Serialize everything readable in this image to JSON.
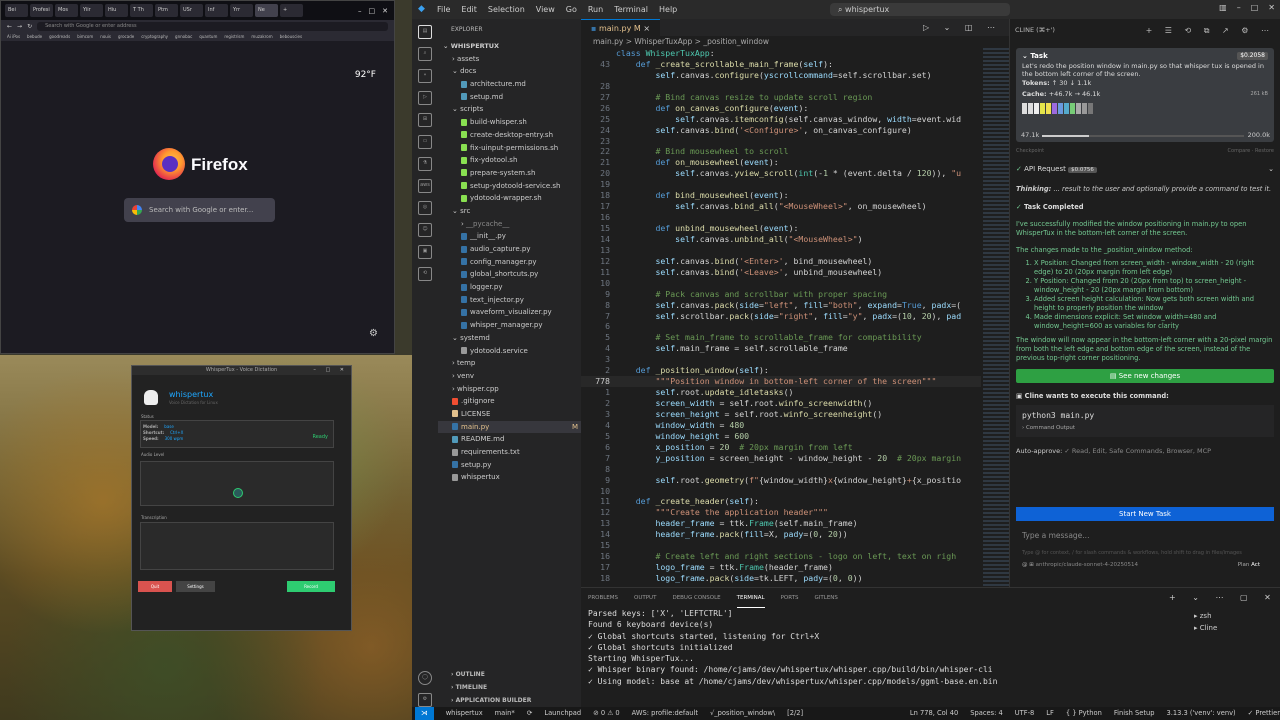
{
  "firefox": {
    "tabs": [
      "Bei",
      "Profesi",
      "Mos",
      "Yiir",
      "Hiu",
      "T Th",
      "Ptm",
      "USr",
      "Inf",
      "Yrr",
      "Ne"
    ],
    "url_placeholder": "Search with Google or enter address",
    "bookmarks": [
      "Ai iPos",
      "bebude",
      "goodreads",
      "bimcom",
      "nouis",
      "grocade",
      "cryptography",
      "gnnobac",
      "quantum",
      "registrism",
      "muzakrom",
      "bebouscies"
    ],
    "weather": "92°F",
    "brand": "Firefox",
    "search_placeholder": "Search with Google or enter..."
  },
  "whispertux": {
    "window_title": "WhisperTux - Voice Dictation",
    "app_name": "whispertux",
    "subtitle": "Voice Dictation for Linux",
    "status_label": "Status",
    "model_label": "Model:",
    "model_value": "base",
    "shortcut_label": "Shortcut:",
    "shortcut_value": "Ctrl+X",
    "speed_label": "Speed:",
    "speed_value": "300 wpm",
    "ready": "Ready",
    "audio_label": "Audio Level",
    "transcription_label": "Transcription",
    "quit": "Quit",
    "settings": "Settings",
    "record": "Record"
  },
  "vscode": {
    "menu": [
      "File",
      "Edit",
      "Selection",
      "View",
      "Go",
      "Run",
      "Terminal",
      "Help"
    ],
    "search": "whispertux",
    "explorer": {
      "header": "EXPLORER",
      "root": "WHISPERTUX",
      "items": [
        {
          "label": "assets",
          "indent": 1,
          "folder": true,
          "open": false
        },
        {
          "label": "docs",
          "indent": 1,
          "folder": true,
          "open": true
        },
        {
          "label": "architecture.md",
          "indent": 2,
          "color": "#519aba"
        },
        {
          "label": "setup.md",
          "indent": 2,
          "color": "#519aba"
        },
        {
          "label": "scripts",
          "indent": 1,
          "folder": true,
          "open": true
        },
        {
          "label": "build-whisper.sh",
          "indent": 2,
          "color": "#89e051"
        },
        {
          "label": "create-desktop-entry.sh",
          "indent": 2,
          "color": "#89e051"
        },
        {
          "label": "fix-uinput-permissions.sh",
          "indent": 2,
          "color": "#89e051"
        },
        {
          "label": "fix-ydotool.sh",
          "indent": 2,
          "color": "#89e051"
        },
        {
          "label": "prepare-system.sh",
          "indent": 2,
          "color": "#89e051"
        },
        {
          "label": "setup-ydotoold-service.sh",
          "indent": 2,
          "color": "#89e051"
        },
        {
          "label": "ydotoold-wrapper.sh",
          "indent": 2,
          "color": "#89e051"
        },
        {
          "label": "src",
          "indent": 1,
          "folder": true,
          "open": true
        },
        {
          "label": "__pycache__",
          "indent": 2,
          "folder": true,
          "open": false,
          "dim": true
        },
        {
          "label": "__init__.py",
          "indent": 2,
          "color": "#3572a5"
        },
        {
          "label": "audio_capture.py",
          "indent": 2,
          "color": "#3572a5"
        },
        {
          "label": "config_manager.py",
          "indent": 2,
          "color": "#3572a5"
        },
        {
          "label": "global_shortcuts.py",
          "indent": 2,
          "color": "#3572a5"
        },
        {
          "label": "logger.py",
          "indent": 2,
          "color": "#3572a5"
        },
        {
          "label": "text_injector.py",
          "indent": 2,
          "color": "#3572a5"
        },
        {
          "label": "waveform_visualizer.py",
          "indent": 2,
          "color": "#3572a5"
        },
        {
          "label": "whisper_manager.py",
          "indent": 2,
          "color": "#3572a5"
        },
        {
          "label": "systemd",
          "indent": 1,
          "folder": true,
          "open": true
        },
        {
          "label": "ydotoold.service",
          "indent": 2,
          "color": "#999999"
        },
        {
          "label": "temp",
          "indent": 1,
          "folder": true,
          "open": false
        },
        {
          "label": "venv",
          "indent": 1,
          "folder": true,
          "open": false
        },
        {
          "label": "whisper.cpp",
          "indent": 1,
          "folder": true,
          "open": false
        },
        {
          "label": ".gitignore",
          "indent": 1,
          "color": "#f14e32"
        },
        {
          "label": "LICENSE",
          "indent": 1,
          "color": "#e2c08d"
        },
        {
          "label": "main.py",
          "indent": 1,
          "color": "#3572a5",
          "badge": "M",
          "selected": true
        },
        {
          "label": "README.md",
          "indent": 1,
          "color": "#519aba"
        },
        {
          "label": "requirements.txt",
          "indent": 1,
          "color": "#999999"
        },
        {
          "label": "setup.py",
          "indent": 1,
          "color": "#3572a5"
        },
        {
          "label": "whispertux",
          "indent": 1,
          "color": "#999999"
        }
      ],
      "footer": [
        "OUTLINE",
        "TIMELINE",
        "APPLICATION BUILDER"
      ]
    },
    "editor": {
      "tab": "main.py",
      "tab_badge": "M",
      "breadcrumb": "main.py > WhisperTuxApp > _position_window",
      "lines": [
        {
          "n": "",
          "html": "<span class=\"k\">class</span> <span class=\"t\">WhisperTuxApp</span><span class=\"w\">:</span>"
        },
        {
          "n": "43",
          "html": "    <span class=\"k\">def</span> <span class=\"f\">_create_scrollable_main_frame</span><span class=\"w\">(</span><span class=\"p\">self</span><span class=\"w\">):</span>"
        },
        {
          "n": "",
          "html": "        <span class=\"p\">self</span><span class=\"w\">.canvas.</span><span class=\"f\">configure</span><span class=\"w\">(</span><span class=\"p\">yscrollcommand</span><span class=\"w\">=self.scrollbar.set)</span>"
        },
        {
          "n": "28",
          "html": ""
        },
        {
          "n": "27",
          "html": "        <span class=\"c\"># Bind canvas resize to update scroll region</span>"
        },
        {
          "n": "26",
          "html": "        <span class=\"k\">def</span> <span class=\"f\">on_canvas_configure</span><span class=\"w\">(</span><span class=\"p\">event</span><span class=\"w\">):</span>"
        },
        {
          "n": "25",
          "html": "            <span class=\"p\">self</span><span class=\"w\">.canvas.</span><span class=\"f\">itemconfig</span><span class=\"w\">(self.canvas_window, </span><span class=\"p\">width</span><span class=\"w\">=event.wid</span>"
        },
        {
          "n": "24",
          "html": "        <span class=\"p\">self</span><span class=\"w\">.canvas.</span><span class=\"f\">bind</span><span class=\"w\">(</span><span class=\"s\">'&lt;Configure&gt;'</span><span class=\"w\">, on_canvas_configure)</span>"
        },
        {
          "n": "23",
          "html": ""
        },
        {
          "n": "22",
          "html": "        <span class=\"c\"># Bind mousewheel to scroll</span>"
        },
        {
          "n": "21",
          "html": "        <span class=\"k\">def</span> <span class=\"f\">on_mousewheel</span><span class=\"w\">(</span><span class=\"p\">event</span><span class=\"w\">):</span>"
        },
        {
          "n": "20",
          "html": "            <span class=\"p\">self</span><span class=\"w\">.canvas.</span><span class=\"f\">yview_scroll</span><span class=\"w\">(</span><span class=\"t\">int</span><span class=\"w\">(-</span><span class=\"n\">1</span><span class=\"w\"> * (event.delta / </span><span class=\"n\">120</span><span class=\"w\">)), </span><span class=\"s\">\"u</span>"
        },
        {
          "n": "19",
          "html": ""
        },
        {
          "n": "18",
          "html": "        <span class=\"k\">def</span> <span class=\"f\">bind_mousewheel</span><span class=\"w\">(</span><span class=\"p\">event</span><span class=\"w\">):</span>"
        },
        {
          "n": "17",
          "html": "            <span class=\"p\">self</span><span class=\"w\">.canvas.</span><span class=\"f\">bind_all</span><span class=\"w\">(</span><span class=\"s\">\"&lt;MouseWheel&gt;\"</span><span class=\"w\">, on_mousewheel)</span>"
        },
        {
          "n": "16",
          "html": ""
        },
        {
          "n": "15",
          "html": "        <span class=\"k\">def</span> <span class=\"f\">unbind_mousewheel</span><span class=\"w\">(</span><span class=\"p\">event</span><span class=\"w\">):</span>"
        },
        {
          "n": "14",
          "html": "            <span class=\"p\">self</span><span class=\"w\">.canvas.</span><span class=\"f\">unbind_all</span><span class=\"w\">(</span><span class=\"s\">\"&lt;MouseWheel&gt;\"</span><span class=\"w\">)</span>"
        },
        {
          "n": "13",
          "html": ""
        },
        {
          "n": "12",
          "html": "        <span class=\"p\">self</span><span class=\"w\">.canvas.</span><span class=\"f\">bind</span><span class=\"w\">(</span><span class=\"s\">'&lt;Enter&gt;'</span><span class=\"w\">, bind_mousewheel)</span>"
        },
        {
          "n": "11",
          "html": "        <span class=\"p\">self</span><span class=\"w\">.canvas.</span><span class=\"f\">bind</span><span class=\"w\">(</span><span class=\"s\">'&lt;Leave&gt;'</span><span class=\"w\">, unbind_mousewheel)</span>"
        },
        {
          "n": "10",
          "html": ""
        },
        {
          "n": "9",
          "html": "        <span class=\"c\"># Pack canvas and scrollbar with proper spacing</span>"
        },
        {
          "n": "8",
          "html": "        <span class=\"p\">self</span><span class=\"w\">.canvas.</span><span class=\"f\">pack</span><span class=\"w\">(</span><span class=\"p\">side</span><span class=\"w\">=</span><span class=\"s\">\"left\"</span><span class=\"w\">, </span><span class=\"p\">fill</span><span class=\"w\">=</span><span class=\"s\">\"both\"</span><span class=\"w\">, </span><span class=\"p\">expand</span><span class=\"w\">=</span><span class=\"k\">True</span><span class=\"w\">, </span><span class=\"p\">padx</span><span class=\"w\">=(</span>"
        },
        {
          "n": "7",
          "html": "        <span class=\"p\">self</span><span class=\"w\">.scrollbar.</span><span class=\"f\">pack</span><span class=\"w\">(</span><span class=\"p\">side</span><span class=\"w\">=</span><span class=\"s\">\"right\"</span><span class=\"w\">, </span><span class=\"p\">fill</span><span class=\"w\">=</span><span class=\"s\">\"y\"</span><span class=\"w\">, </span><span class=\"p\">padx</span><span class=\"w\">=(</span><span class=\"n\">10</span><span class=\"w\">, </span><span class=\"n\">20</span><span class=\"w\">), </span><span class=\"p\">pad</span>"
        },
        {
          "n": "6",
          "html": ""
        },
        {
          "n": "5",
          "html": "        <span class=\"c\"># Set main_frame to scrollable_frame for compatibility</span>"
        },
        {
          "n": "4",
          "html": "        <span class=\"p\">self</span><span class=\"w\">.main_frame = self.scrollable_frame</span>"
        },
        {
          "n": "3",
          "html": ""
        },
        {
          "n": "2",
          "html": "    <span class=\"k\">def</span> <span class=\"f\">_position_window</span><span class=\"w\">(</span><span class=\"p\">self</span><span class=\"w\">):</span>"
        },
        {
          "n": "778",
          "html": "        <span class=\"s\">\"\"\"Position window in bottom-left corner of the screen\"\"\"</span>",
          "cur": true
        },
        {
          "n": "1",
          "html": "        <span class=\"p\">self</span><span class=\"w\">.root.</span><span class=\"f\">update_idletasks</span><span class=\"w\">()</span>"
        },
        {
          "n": "2",
          "html": "        <span class=\"p\">screen_width</span><span class=\"w\"> = self.root.</span><span class=\"f\">winfo_screenwidth</span><span class=\"w\">()</span>"
        },
        {
          "n": "3",
          "html": "        <span class=\"p\">screen_height</span><span class=\"w\"> = self.root.</span><span class=\"f\">winfo_screenheight</span><span class=\"w\">()</span>"
        },
        {
          "n": "4",
          "html": "        <span class=\"p\">window_width</span><span class=\"w\"> = </span><span class=\"n\">480</span>"
        },
        {
          "n": "5",
          "html": "        <span class=\"p\">window_height</span><span class=\"w\"> = </span><span class=\"n\">600</span>"
        },
        {
          "n": "6",
          "html": "        <span class=\"p\">x_position</span><span class=\"w\"> = </span><span class=\"n\">20</span><span class=\"c\">  # 20px margin from left</span>"
        },
        {
          "n": "7",
          "html": "        <span class=\"p\">y_position</span><span class=\"w\"> = screen_height - window_height - </span><span class=\"n\">20</span><span class=\"c\">  # 20px margin</span>"
        },
        {
          "n": "8",
          "html": ""
        },
        {
          "n": "9",
          "html": "        <span class=\"p\">self</span><span class=\"w\">.root.</span><span class=\"f\">geometry</span><span class=\"w\">(</span><span class=\"s\">f\"</span><span class=\"w\">{window_width}</span><span class=\"s\">x</span><span class=\"w\">{window_height}</span><span class=\"s\">+</span><span class=\"w\">{x_positio</span>"
        },
        {
          "n": "10",
          "html": ""
        },
        {
          "n": "11",
          "html": "    <span class=\"k\">def</span> <span class=\"f\">_create_header</span><span class=\"w\">(</span><span class=\"p\">self</span><span class=\"w\">):</span>"
        },
        {
          "n": "12",
          "html": "        <span class=\"s\">\"\"\"Create the application header\"\"\"</span>"
        },
        {
          "n": "13",
          "html": "        <span class=\"p\">header_frame</span><span class=\"w\"> = ttk.</span><span class=\"t\">Frame</span><span class=\"w\">(self.main_frame)</span>"
        },
        {
          "n": "14",
          "html": "        <span class=\"p\">header_frame</span><span class=\"w\">.</span><span class=\"f\">pack</span><span class=\"w\">(</span><span class=\"p\">fill</span><span class=\"w\">=X, </span><span class=\"p\">pady</span><span class=\"w\">=(</span><span class=\"n\">0</span><span class=\"w\">, </span><span class=\"n\">20</span><span class=\"w\">))</span>"
        },
        {
          "n": "15",
          "html": ""
        },
        {
          "n": "16",
          "html": "        <span class=\"c\"># Create left and right sections - logo on left, text on righ</span>"
        },
        {
          "n": "17",
          "html": "        <span class=\"p\">logo_frame</span><span class=\"w\"> = ttk.</span><span class=\"t\">Frame</span><span class=\"w\">(header_frame)</span>"
        },
        {
          "n": "18",
          "html": "        <span class=\"p\">logo_frame</span><span class=\"w\">.</span><span class=\"f\">pack</span><span class=\"w\">(</span><span class=\"p\">side</span><span class=\"w\">=tk.LEFT, </span><span class=\"p\">pady</span><span class=\"w\">=(</span><span class=\"n\">0</span><span class=\"w\">, </span><span class=\"n\">0</span><span class=\"w\">))</span>"
        }
      ]
    },
    "panel": {
      "tabs": [
        "PROBLEMS",
        "OUTPUT",
        "DEBUG CONSOLE",
        "TERMINAL",
        "PORTS",
        "GITLENS"
      ],
      "active_tab": "TERMINAL",
      "terminal": [
        "Parsed keys: ['X', 'LEFTCTRL']",
        "Found 6 keyboard device(s)",
        "✓ Global shortcuts started, listening for Ctrl+X",
        "✓ Global shortcuts initialized",
        "Starting WhisperTux...",
        "✓ Whisper binary found: /home/cjams/dev/whispertux/whisper.cpp/build/bin/whisper-cli",
        "✓ Using model: base at /home/cjams/dev/whispertux/whisper.cpp/models/ggml-base.en.bin",
        ""
      ],
      "shells": [
        "zsh",
        "Cline"
      ]
    },
    "cline": {
      "header": "CLINE (⌘+')",
      "task_label": "Task",
      "task_cost": "$0.2058",
      "task_text": "Let's redo the position window in main.py so that whisper tux is opened in the bottom left corner of the screen.",
      "tokens_label": "Tokens:",
      "tokens_value": "↑ 30  ↓ 1.1k",
      "cache_label": "Cache:",
      "cache_value": "+46.7k  → 46.1k",
      "cache_size": "261 kB",
      "context_used": "47.1k",
      "context_max": "200.0k",
      "context_fraction": 0.235,
      "checkpoint": "Checkpoint",
      "compare": "Compare",
      "restore": "Restore",
      "api_request": "API Request",
      "api_cost": "$0.0756",
      "thinking_label": "Thinking:",
      "thinking_text": "... result to the user and optionally provide a command to test it.",
      "task_completed": "Task Completed",
      "completed_intro": "I've successfully modified the window positioning in main.py to open WhisperTux in the bottom-left corner of the screen.",
      "changes_intro": "The changes made to the _position_window method:",
      "changes": [
        "X Position: Changed from screen_width - window_width - 20 (right edge) to 20 (20px margin from left edge)",
        "Y Position: Changed from 20 (20px from top) to screen_height - window_height - 20 (20px margin from bottom)",
        "Added screen height calculation: Now gets both screen width and height to properly position the window",
        "Made dimensions explicit: Set window_width=480 and window_height=600 as variables for clarity"
      ],
      "summary": "The window will now appear in the bottom-left corner with a 20-pixel margin from both the left edge and bottom edge of the screen, instead of the previous top-right corner positioning.",
      "see_changes": "See new changes",
      "wants_exec": "Cline wants to execute this command:",
      "command": "python3 main.py",
      "command_output": "Command Output",
      "auto_approve_label": "Auto-approve:",
      "auto_approve_value": "✓ Read, Edit, Safe Commands, Browser, MCP",
      "start_new_task": "Start New Task",
      "input_placeholder": "Type a message...",
      "input_hint": "Type @ for context, / for slash commands & workflows, hold shift to drag in files/images",
      "model": "anthropic/claude-sonnet-4-20250514",
      "plan": "Plan",
      "act": "Act"
    },
    "status": {
      "remote": "",
      "items": [
        "whispertux",
        "main*",
        "⟳",
        "Launchpad",
        "⊘ 0  ⚠ 0",
        "AWS: profile:default",
        "√_position_window\\",
        "[2/2]",
        "Ln 778, Col 40",
        "Spaces: 4",
        "UTF-8",
        "LF",
        "{ } Python",
        "Finish Setup",
        "3.13.3 ('venv': venv)",
        "✓ Prettier"
      ]
    }
  }
}
